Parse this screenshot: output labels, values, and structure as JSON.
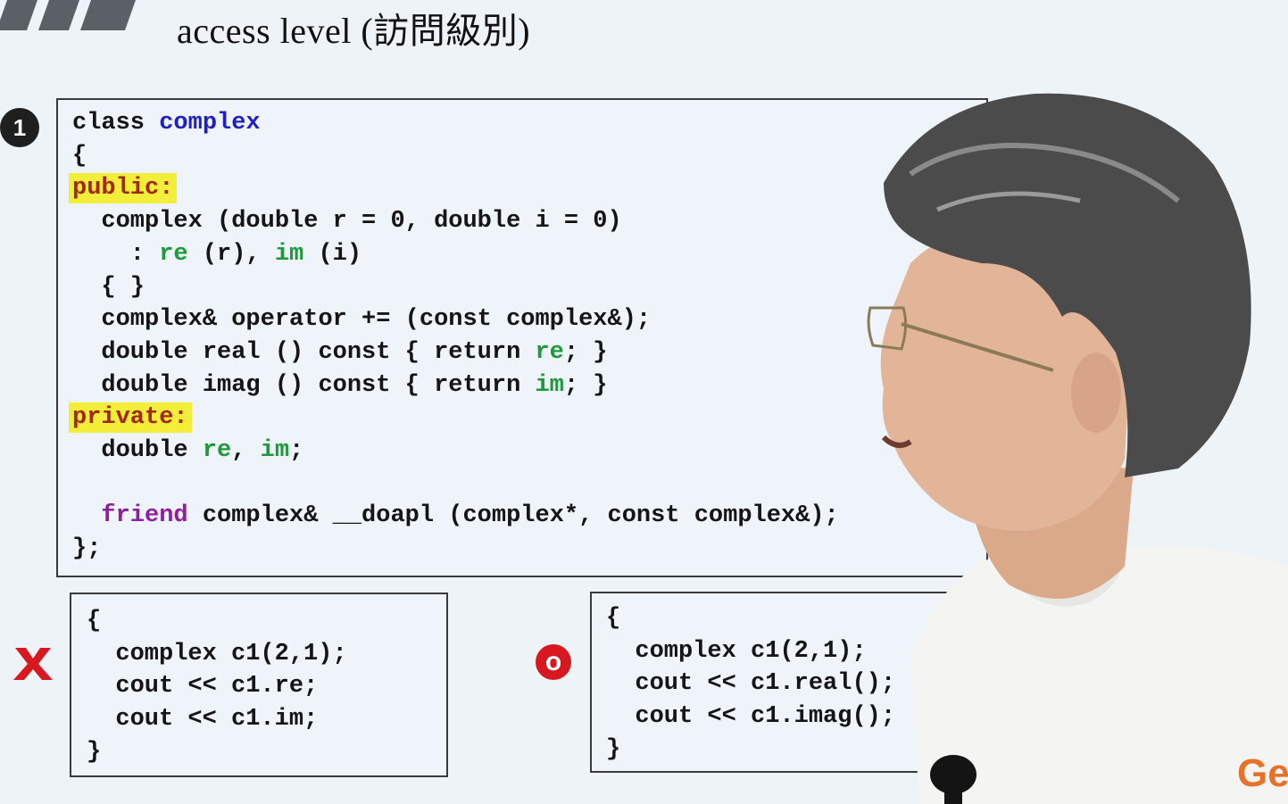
{
  "slide": {
    "title": "access level (訪問級別)",
    "step_number": "1",
    "brand_fragment": "Ge"
  },
  "main_code": {
    "lines": [
      [
        "class ",
        "complex"
      ],
      [
        "{"
      ],
      [
        "public:"
      ],
      [
        "  complex (double r = 0, double i = 0)"
      ],
      [
        "    : ",
        "re",
        " (r), ",
        "im",
        " (i)"
      ],
      [
        "  { }"
      ],
      [
        "  complex& operator += (const complex&);"
      ],
      [
        "  double real () const { return ",
        "re",
        "; }"
      ],
      [
        "  double imag () const { return ",
        "im",
        "; }"
      ],
      [
        "private:"
      ],
      [
        "  double ",
        "re",
        ", ",
        "im",
        ";"
      ],
      [
        ""
      ],
      [
        "  ",
        "friend",
        " complex& __doapl (complex*, const complex&);"
      ],
      [
        "};"
      ]
    ]
  },
  "bad_example": {
    "mark": "X",
    "lines": [
      "{",
      "  complex c1(2,1);",
      "  cout << c1.re;",
      "  cout << c1.im;",
      "}"
    ]
  },
  "good_example": {
    "mark": "O",
    "lines": [
      "{",
      "  complex c1(2,1);",
      "  cout << c1.real();",
      "  cout << c1.imag();",
      "}"
    ]
  },
  "colors": {
    "background": "#eef3f8",
    "keyword_blue": "#1f1fc8",
    "member_green": "#1f9a3a",
    "friend_purple": "#8e1fa0",
    "access_highlight": "#f2ee3a",
    "access_text": "#a4270f",
    "mark_red": "#d8181f"
  }
}
